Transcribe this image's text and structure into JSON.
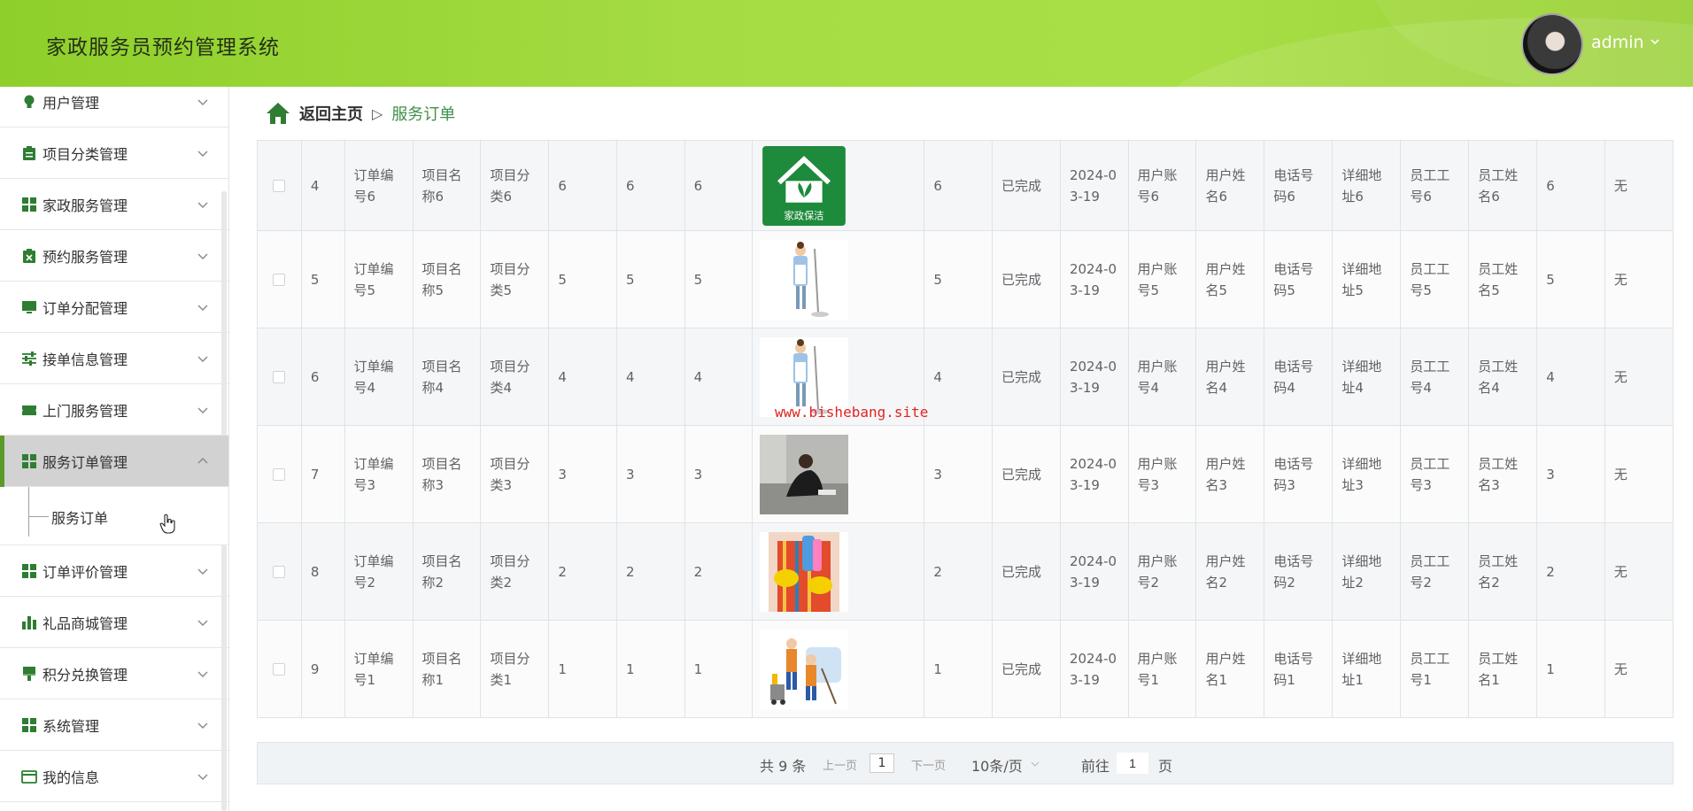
{
  "header": {
    "title": "家政服务员预约管理系统",
    "user": "admin"
  },
  "sidebar": {
    "items": [
      {
        "label": "用户管理",
        "icon": "bulb-icon"
      },
      {
        "label": "项目分类管理",
        "icon": "clipboard-icon"
      },
      {
        "label": "家政服务管理",
        "icon": "grid-icon"
      },
      {
        "label": "预约服务管理",
        "icon": "clipboard-x-icon"
      },
      {
        "label": "订单分配管理",
        "icon": "monitor-icon"
      },
      {
        "label": "接单信息管理",
        "icon": "sliders-icon"
      },
      {
        "label": "上门服务管理",
        "icon": "ticket-icon"
      },
      {
        "label": "服务订单管理",
        "icon": "grid-icon"
      },
      {
        "label": "订单评价管理",
        "icon": "grid-icon"
      },
      {
        "label": "礼品商城管理",
        "icon": "bar-chart-icon"
      },
      {
        "label": "积分兑换管理",
        "icon": "brush-icon"
      },
      {
        "label": "系统管理",
        "icon": "grid-icon"
      },
      {
        "label": "我的信息",
        "icon": "card-icon"
      }
    ],
    "active_sub": "服务订单",
    "accent_color": "#5a9a2a"
  },
  "breadcrumb": {
    "home": "返回主页",
    "separator": "▷",
    "current": "服务订单"
  },
  "table": {
    "rows": [
      {
        "no": "4",
        "order": "订单编号6",
        "proj": "项目名称6",
        "cat": "项目分类6",
        "a": "6",
        "b": "6",
        "c": "6",
        "img": "house-logo",
        "img_text": "家政保洁",
        "d": "6",
        "status": "已完成",
        "date": "2024-03-19",
        "uacc": "用户账号6",
        "uname": "用户姓名6",
        "phone": "电话号码6",
        "addr": "详细地址6",
        "eno": "员工工号6",
        "ename": "员工姓名6",
        "e": "6",
        "tail": "无"
      },
      {
        "no": "5",
        "order": "订单编号5",
        "proj": "项目名称5",
        "cat": "项目分类5",
        "a": "5",
        "b": "5",
        "c": "5",
        "img": "cleaner-mop",
        "d": "5",
        "status": "已完成",
        "date": "2024-03-19",
        "uacc": "用户账号5",
        "uname": "用户姓名5",
        "phone": "电话号码5",
        "addr": "详细地址5",
        "eno": "员工工号5",
        "ename": "员工姓名5",
        "e": "5",
        "tail": "无"
      },
      {
        "no": "6",
        "order": "订单编号4",
        "proj": "项目名称4",
        "cat": "项目分类4",
        "a": "4",
        "b": "4",
        "c": "4",
        "img": "cleaner-mop",
        "d": "4",
        "status": "已完成",
        "date": "2024-03-19",
        "uacc": "用户账号4",
        "uname": "用户姓名4",
        "phone": "电话号码4",
        "addr": "详细地址4",
        "eno": "员工工号4",
        "ename": "员工姓名4",
        "e": "4",
        "tail": "无"
      },
      {
        "no": "7",
        "order": "订单编号3",
        "proj": "项目名称3",
        "cat": "项目分类3",
        "a": "3",
        "b": "3",
        "c": "3",
        "img": "floor-cleaning-photo",
        "d": "3",
        "status": "已完成",
        "date": "2024-03-19",
        "uacc": "用户账号3",
        "uname": "用户姓名3",
        "phone": "电话号码3",
        "addr": "详细地址3",
        "eno": "员工工号3",
        "ename": "员工姓名3",
        "e": "3",
        "tail": "无"
      },
      {
        "no": "8",
        "order": "订单编号2",
        "proj": "项目名称2",
        "cat": "项目分类2",
        "a": "2",
        "b": "2",
        "c": "2",
        "img": "cleaning-tools-photo",
        "d": "2",
        "status": "已完成",
        "date": "2024-03-19",
        "uacc": "用户账号2",
        "uname": "用户姓名2",
        "phone": "电话号码2",
        "addr": "详细地址2",
        "eno": "员工工号2",
        "ename": "员工姓名2",
        "e": "2",
        "tail": "无"
      },
      {
        "no": "9",
        "order": "订单编号1",
        "proj": "项目名称1",
        "cat": "项目分类1",
        "a": "1",
        "b": "1",
        "c": "1",
        "img": "cleaning-team-illustration",
        "d": "1",
        "status": "已完成",
        "date": "2024-03-19",
        "uacc": "用户账号1",
        "uname": "用户姓名1",
        "phone": "电话号码1",
        "addr": "详细地址1",
        "eno": "员工工号1",
        "ename": "员工姓名1",
        "e": "1",
        "tail": "无"
      }
    ]
  },
  "watermark": "www.bishebang.site",
  "pagination": {
    "total": "共 9 条",
    "prev": "上一页",
    "page": "1",
    "next": "下一页",
    "size": "10条/页",
    "goto": "前往",
    "goto_value": "1",
    "page_suffix": "页"
  }
}
